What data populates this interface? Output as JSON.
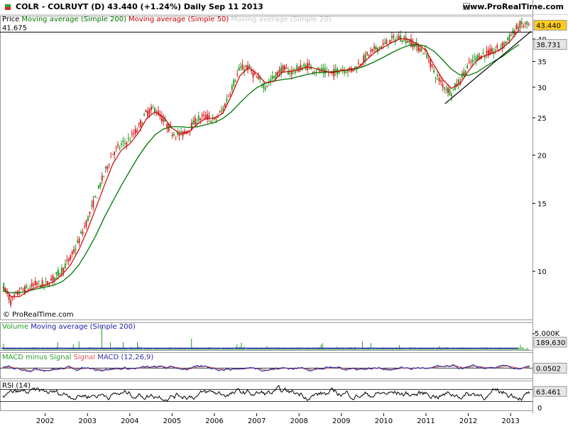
{
  "header": {
    "title": "COLR - COLRUYT (D)   43.440 (+1.24%)   Daily  Sep 11 2013",
    "site": "www.ProRealTime.com"
  },
  "copyright": "© ProRealTime.com",
  "colors": {
    "price_up": "#2ca02c",
    "price_down": "#d62728",
    "ma200": "#007700",
    "ma50": "#cc0000",
    "ma20": "#c8c8c8",
    "volume": "#1f9e1f",
    "volume_ma": "#1a1aa8",
    "macd": "#3333aa",
    "signal": "#e05555",
    "rsi": "#000000",
    "label_yellow": "#ffcc22",
    "label_gray": "#e6e6e6"
  },
  "chart_data": [
    {
      "type": "line",
      "panel": "price",
      "legend": [
        {
          "text": "Price",
          "color": "#000000"
        },
        {
          "text": "Moving average (Simple 200)",
          "color": "#007700"
        },
        {
          "text": "Moving average (Simple 50)",
          "color": "#cc0000"
        },
        {
          "text": "Moving average (Simple 20)",
          "color": "#c8c8c8"
        }
      ],
      "scale": "log",
      "ylim": [
        7.5,
        46
      ],
      "yticks": [
        10,
        15,
        20,
        25,
        30,
        35,
        40
      ],
      "xlim": [
        2001.5,
        2013.95
      ],
      "xticks": [
        "2002",
        "2003",
        "2004",
        "2005",
        "2006",
        "2007",
        "2008",
        "2009",
        "2010",
        "2011",
        "2012",
        "2013"
      ],
      "x": [
        2001.5,
        2001.7,
        2001.9,
        2002.1,
        2002.3,
        2002.5,
        2002.7,
        2002.9,
        2003.1,
        2003.3,
        2003.5,
        2003.7,
        2003.9,
        2004.1,
        2004.3,
        2004.5,
        2004.7,
        2004.9,
        2005.1,
        2005.3,
        2005.5,
        2005.7,
        2005.9,
        2006.1,
        2006.3,
        2006.5,
        2006.7,
        2006.9,
        2007.1,
        2007.3,
        2007.5,
        2007.7,
        2007.9,
        2008.1,
        2008.3,
        2008.5,
        2008.7,
        2008.9,
        2009.1,
        2009.3,
        2009.5,
        2009.7,
        2009.9,
        2010.1,
        2010.3,
        2010.5,
        2010.7,
        2010.9,
        2011.1,
        2011.3,
        2011.5,
        2011.7,
        2011.9,
        2012.1,
        2012.3,
        2012.5,
        2012.7,
        2012.9,
        2013.1,
        2013.3,
        2013.5,
        2013.7
      ],
      "series": [
        {
          "name": "Price",
          "values": [
            9.2,
            8.3,
            8.9,
            9.0,
            9.3,
            9.2,
            9.6,
            10.1,
            10.8,
            12.0,
            13.6,
            15.6,
            17.9,
            20.3,
            21.2,
            22.0,
            23.5,
            25.8,
            26.4,
            24.5,
            23.0,
            22.5,
            23.4,
            24.8,
            25.2,
            24.6,
            26.2,
            29.8,
            33.5,
            33.8,
            31.6,
            30.2,
            31.8,
            33.5,
            32.8,
            33.6,
            34.1,
            33.2,
            32.9,
            32.6,
            33.6,
            33.1,
            34.2,
            36.1,
            37.6,
            38.6,
            39.8,
            40.5,
            39.6,
            38.2,
            36.9,
            32.6,
            30.4,
            29.1,
            31.2,
            34.1,
            36.0,
            36.6,
            37.1,
            38.4,
            40.6,
            43.44
          ]
        },
        {
          "name": "Moving average (Simple 200)",
          "values": [
            8.9,
            8.8,
            8.8,
            8.9,
            9.0,
            9.1,
            9.2,
            9.4,
            9.8,
            10.4,
            11.3,
            12.4,
            13.8,
            15.2,
            16.7,
            18.2,
            19.8,
            21.3,
            22.6,
            23.4,
            23.7,
            23.7,
            23.6,
            23.7,
            24.0,
            24.3,
            24.9,
            25.9,
            27.3,
            28.7,
            29.9,
            30.7,
            31.1,
            31.4,
            31.6,
            32.0,
            32.4,
            32.7,
            32.8,
            32.9,
            33.1,
            33.3,
            33.6,
            34.2,
            35.0,
            35.9,
            36.9,
            37.8,
            38.5,
            38.7,
            38.3,
            37.1,
            35.3,
            33.4,
            32.3,
            32.2,
            32.8,
            33.9,
            35.0,
            36.0,
            37.4,
            38.731
          ]
        },
        {
          "name": "Moving average (Simple 50)",
          "values": [
            9.1,
            8.6,
            8.6,
            8.9,
            9.1,
            9.2,
            9.4,
            9.8,
            10.4,
            11.4,
            12.8,
            14.6,
            16.7,
            19.0,
            20.6,
            21.4,
            22.8,
            24.9,
            25.9,
            25.1,
            23.5,
            22.7,
            23.0,
            24.1,
            24.9,
            24.9,
            25.7,
            28.5,
            32.1,
            33.7,
            32.6,
            30.8,
            31.1,
            32.8,
            33.0,
            33.3,
            33.9,
            33.5,
            33.0,
            32.7,
            33.2,
            33.3,
            33.8,
            35.4,
            37.0,
            38.1,
            39.2,
            40.1,
            39.9,
            38.8,
            37.4,
            34.1,
            31.4,
            29.8,
            30.6,
            33.0,
            35.2,
            36.3,
            36.8,
            37.8,
            39.6,
            42.2
          ]
        }
      ],
      "annotations": [
        "41.675",
        "43.440",
        "38.731"
      ]
    },
    {
      "type": "bar",
      "panel": "volume",
      "legend": [
        {
          "text": "Volume",
          "color": "#1f9e1f"
        },
        {
          "text": "Moving average (Simple 200)",
          "color": "#1a1aa8"
        }
      ],
      "ylim": [
        0,
        6000
      ],
      "yticks_label": "5.000K",
      "last_value": "189,630"
    },
    {
      "type": "line",
      "panel": "macd",
      "legend": [
        {
          "text": "MACD minus Signal",
          "color": "#2ca02c"
        },
        {
          "text": "Signal",
          "color": "#e05555"
        },
        {
          "text": "MACD (12,26,9)",
          "color": "#3333aa"
        }
      ],
      "ylim": [
        -2.5,
        2.5
      ],
      "last_value": "0.0502"
    },
    {
      "type": "line",
      "panel": "rsi",
      "legend": [
        {
          "text": "RSI (14)",
          "color": "#000000"
        }
      ],
      "ylim": [
        0,
        100
      ],
      "levels": [
        30,
        70
      ],
      "yticks_label": "0",
      "last_value": "63.461"
    }
  ]
}
